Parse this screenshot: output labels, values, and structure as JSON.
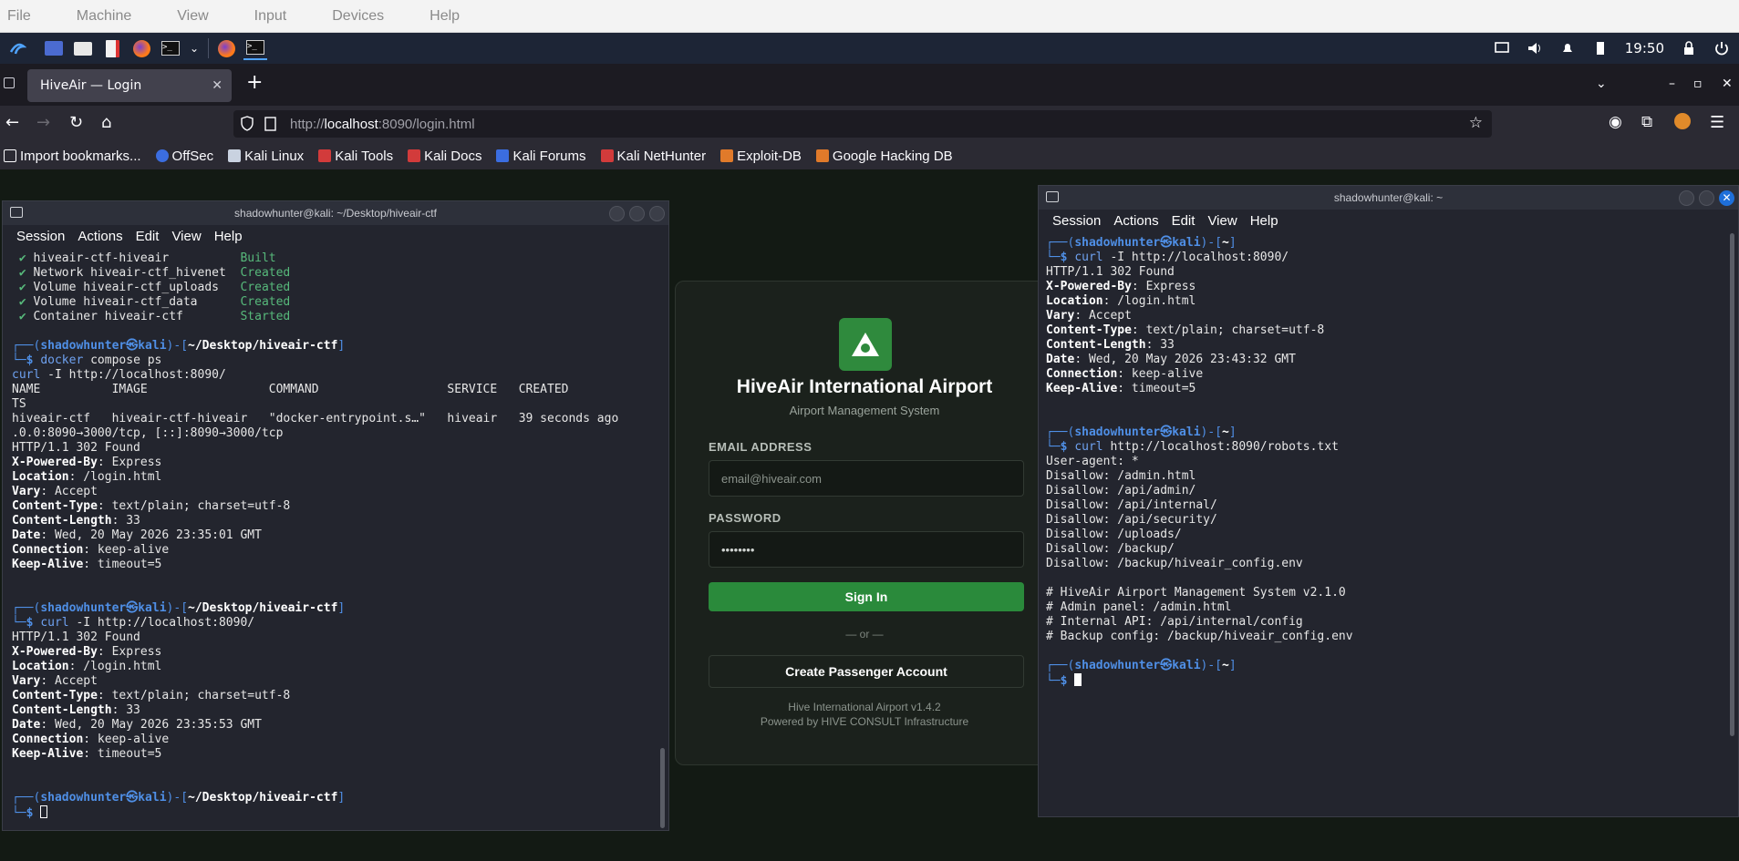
{
  "vm_menu": [
    "File",
    "Machine",
    "View",
    "Input",
    "Devices",
    "Help"
  ],
  "panel": {
    "clock": "19:50"
  },
  "browser": {
    "tab_title": "HiveAir — Login",
    "url_prefix": "http://",
    "url_host": "localhost",
    "url_rest": ":8090/login.html",
    "bookmarks": [
      "Import bookmarks...",
      "OffSec",
      "Kali Linux",
      "Kali Tools",
      "Kali Docs",
      "Kali Forums",
      "Kali NetHunter",
      "Exploit-DB",
      "Google Hacking DB"
    ]
  },
  "login": {
    "title": "HiveAir International Airport",
    "subtitle": "Airport Management System",
    "email_label": "EMAIL ADDRESS",
    "email_placeholder": "email@hiveair.com",
    "password_label": "PASSWORD",
    "password_value": "••••••••",
    "sign_in": "Sign In",
    "or": "— or —",
    "create_account": "Create Passenger Account",
    "footer1": "Hive International Airport v1.4.2",
    "footer2": "Powered by HIVE CONSULT Infrastructure"
  },
  "term_left": {
    "title": "shadowhunter@kali: ~/Desktop/hiveair-ctf",
    "menu": [
      "Session",
      "Actions",
      "Edit",
      "View",
      "Help"
    ]
  },
  "term_right": {
    "title": "shadowhunter@kali: ~",
    "menu": [
      "Session",
      "Actions",
      "Edit",
      "View",
      "Help"
    ]
  }
}
